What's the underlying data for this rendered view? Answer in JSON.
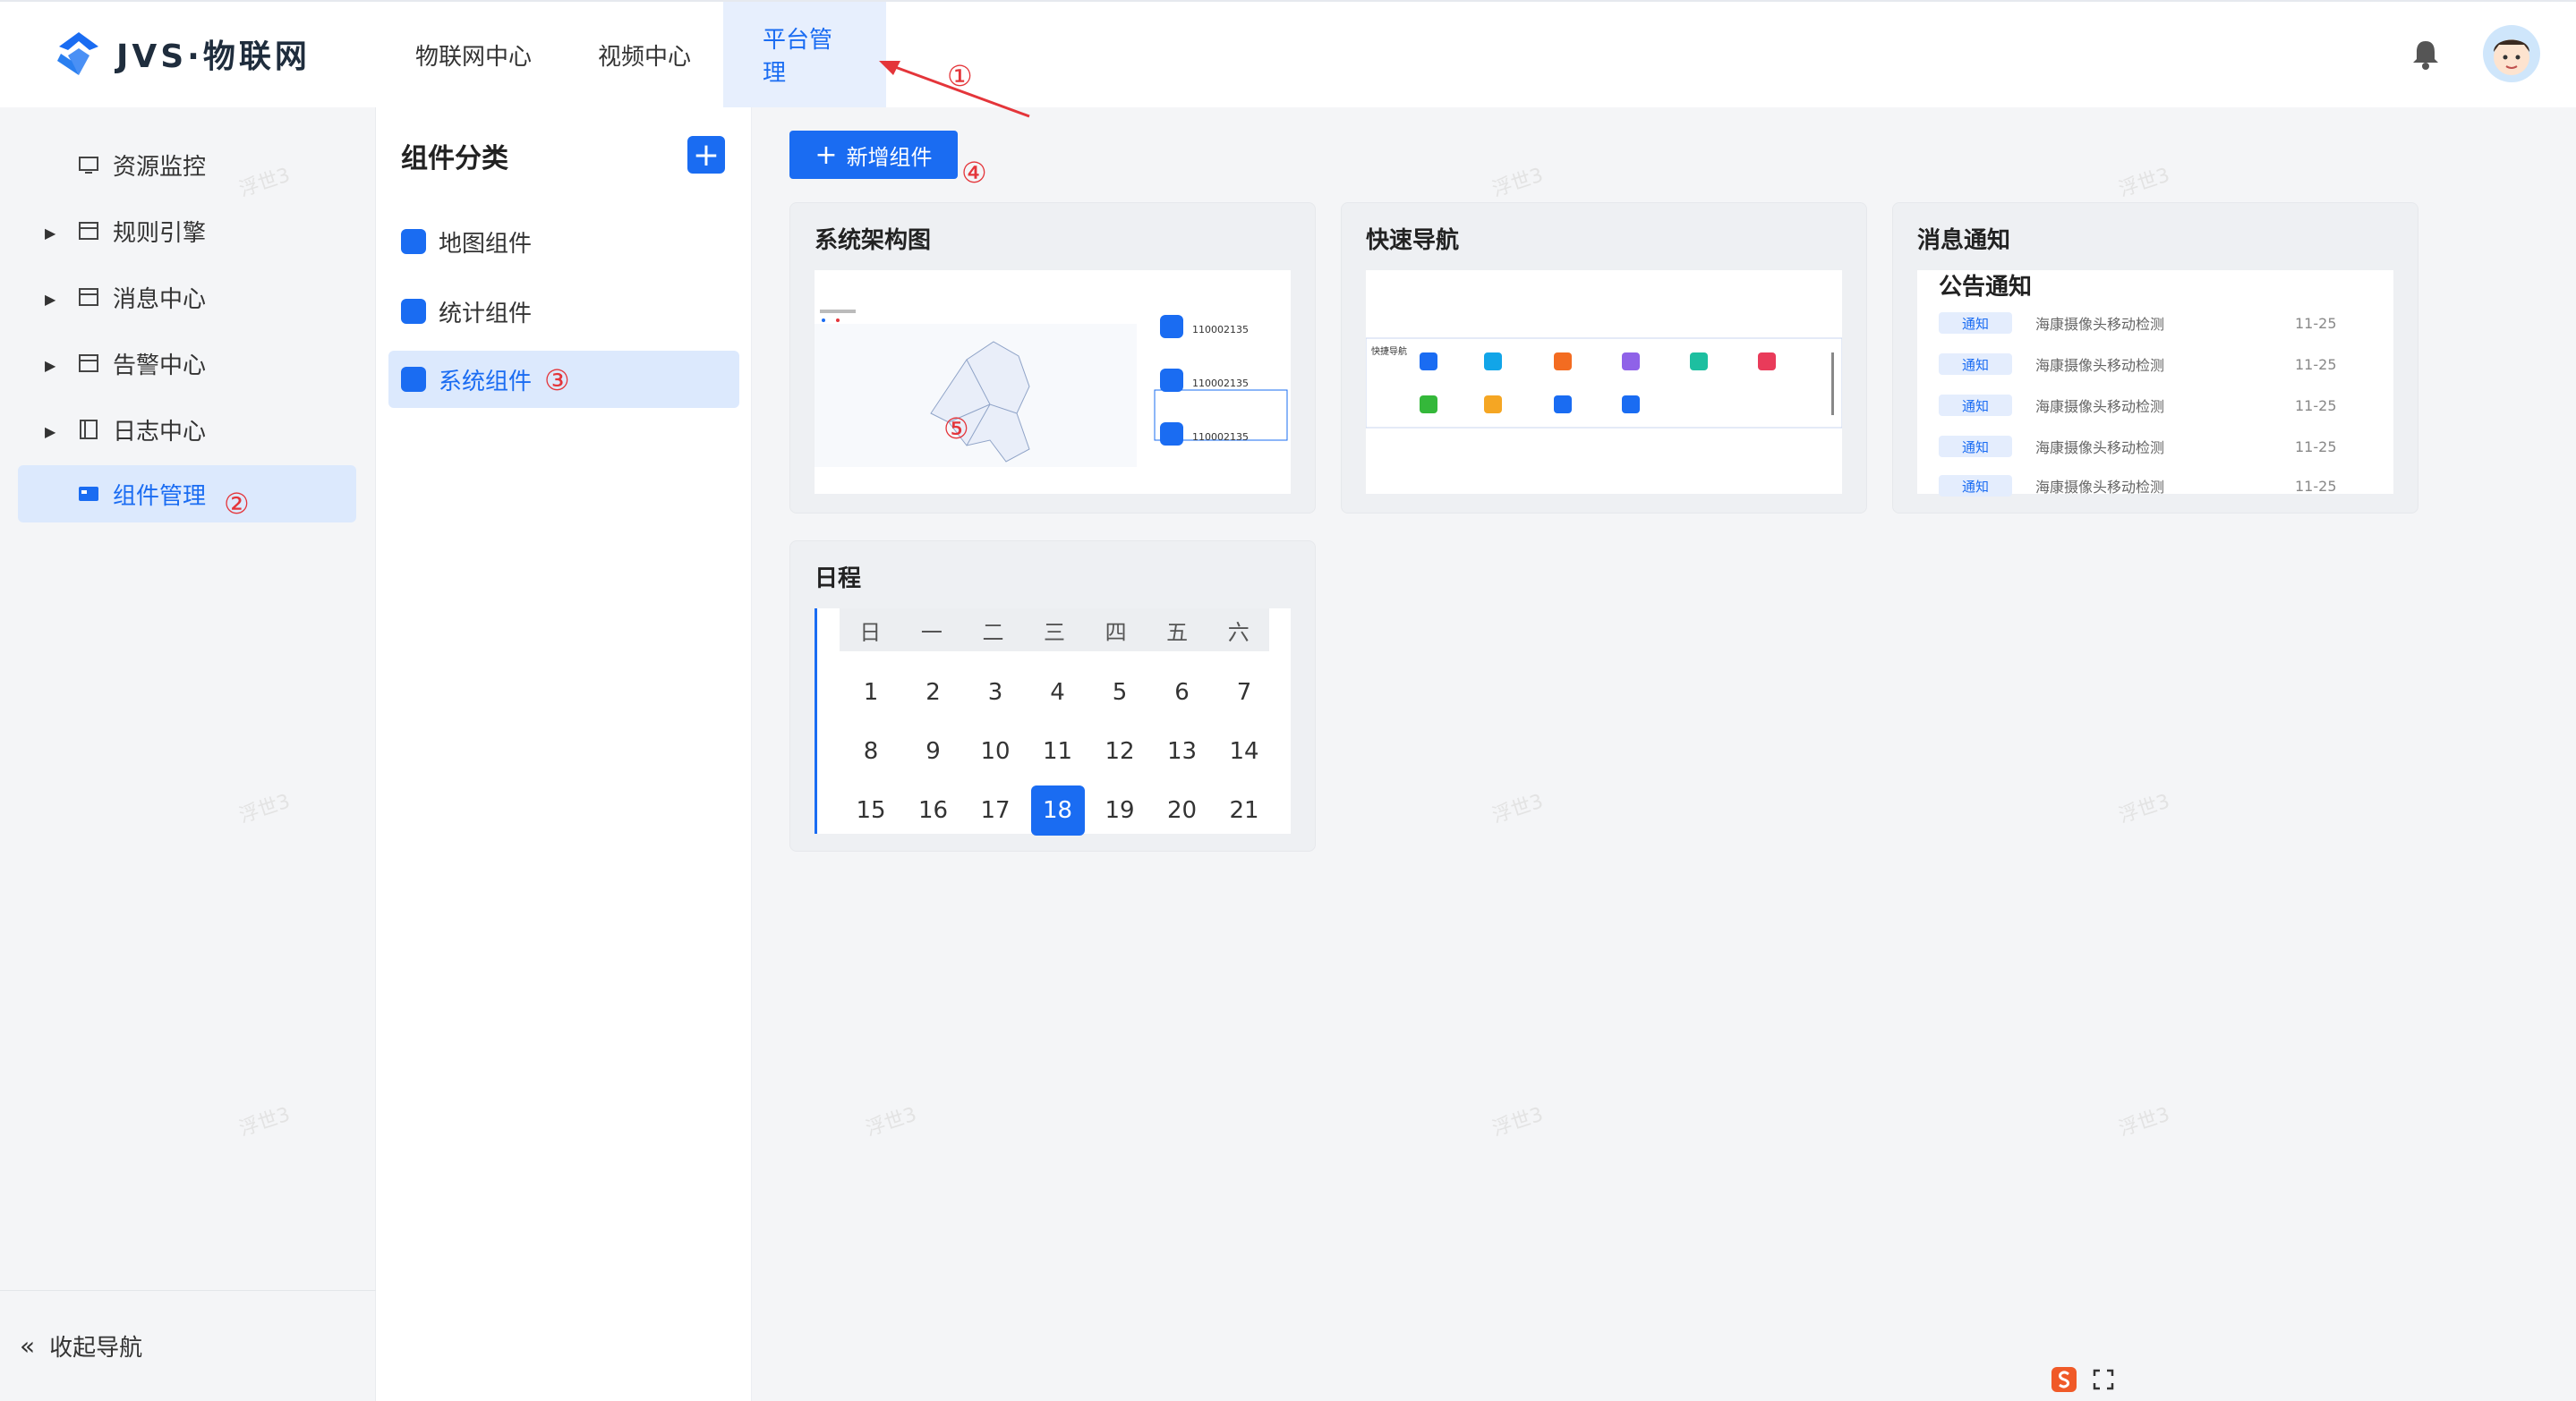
{
  "brand": {
    "name": "JVS·物联网"
  },
  "topnav": [
    {
      "label": "物联网中心"
    },
    {
      "label": "视频中心"
    },
    {
      "label": "平台管理"
    }
  ],
  "sidebar": {
    "items": [
      {
        "label": "资源监控",
        "icon": "monitor-icon"
      },
      {
        "label": "规则引擎",
        "icon": "rules-icon"
      },
      {
        "label": "消息中心",
        "icon": "message-icon"
      },
      {
        "label": "告警中心",
        "icon": "alarm-icon"
      },
      {
        "label": "日志中心",
        "icon": "log-icon"
      },
      {
        "label": "组件管理",
        "icon": "component-icon"
      }
    ],
    "collapse_label": "收起导航"
  },
  "categories": {
    "title": "组件分类",
    "items": [
      {
        "label": "地图组件"
      },
      {
        "label": "统计组件"
      },
      {
        "label": "系统组件"
      }
    ]
  },
  "toolbar": {
    "add_label": "新增组件"
  },
  "cards": {
    "architecture": {
      "title": "系统架构图",
      "stats": [
        {
          "value": "110002135"
        },
        {
          "value": "110002135"
        },
        {
          "value": "110002135"
        }
      ]
    },
    "quicknav": {
      "title": "快速导航",
      "header": "快捷导航"
    },
    "notice": {
      "title": "消息通知",
      "heading": "公告通知",
      "rows": [
        {
          "tag": "通知",
          "text": "海康摄像头移动检测",
          "date": "11-25"
        },
        {
          "tag": "通知",
          "text": "海康摄像头移动检测",
          "date": "11-25"
        },
        {
          "tag": "通知",
          "text": "海康摄像头移动检测",
          "date": "11-25"
        },
        {
          "tag": "通知",
          "text": "海康摄像头移动检测",
          "date": "11-25"
        },
        {
          "tag": "通知",
          "text": "海康摄像头移动检测",
          "date": "11-25"
        }
      ]
    },
    "calendar": {
      "title": "日程",
      "weekdays": [
        "日",
        "一",
        "二",
        "三",
        "四",
        "五",
        "六"
      ],
      "days": [
        "1",
        "2",
        "3",
        "4",
        "5",
        "6",
        "7",
        "8",
        "9",
        "10",
        "11",
        "12",
        "13",
        "14",
        "15",
        "16",
        "17",
        "18",
        "19",
        "20",
        "21"
      ],
      "today": "18"
    }
  },
  "markers": {
    "m1": "①",
    "m2": "②",
    "m3": "③",
    "m4": "④",
    "m5": "⑤"
  },
  "watermark": "浮世3",
  "colors": {
    "accent": "#1a6cf2",
    "marker": "#e4353a"
  }
}
